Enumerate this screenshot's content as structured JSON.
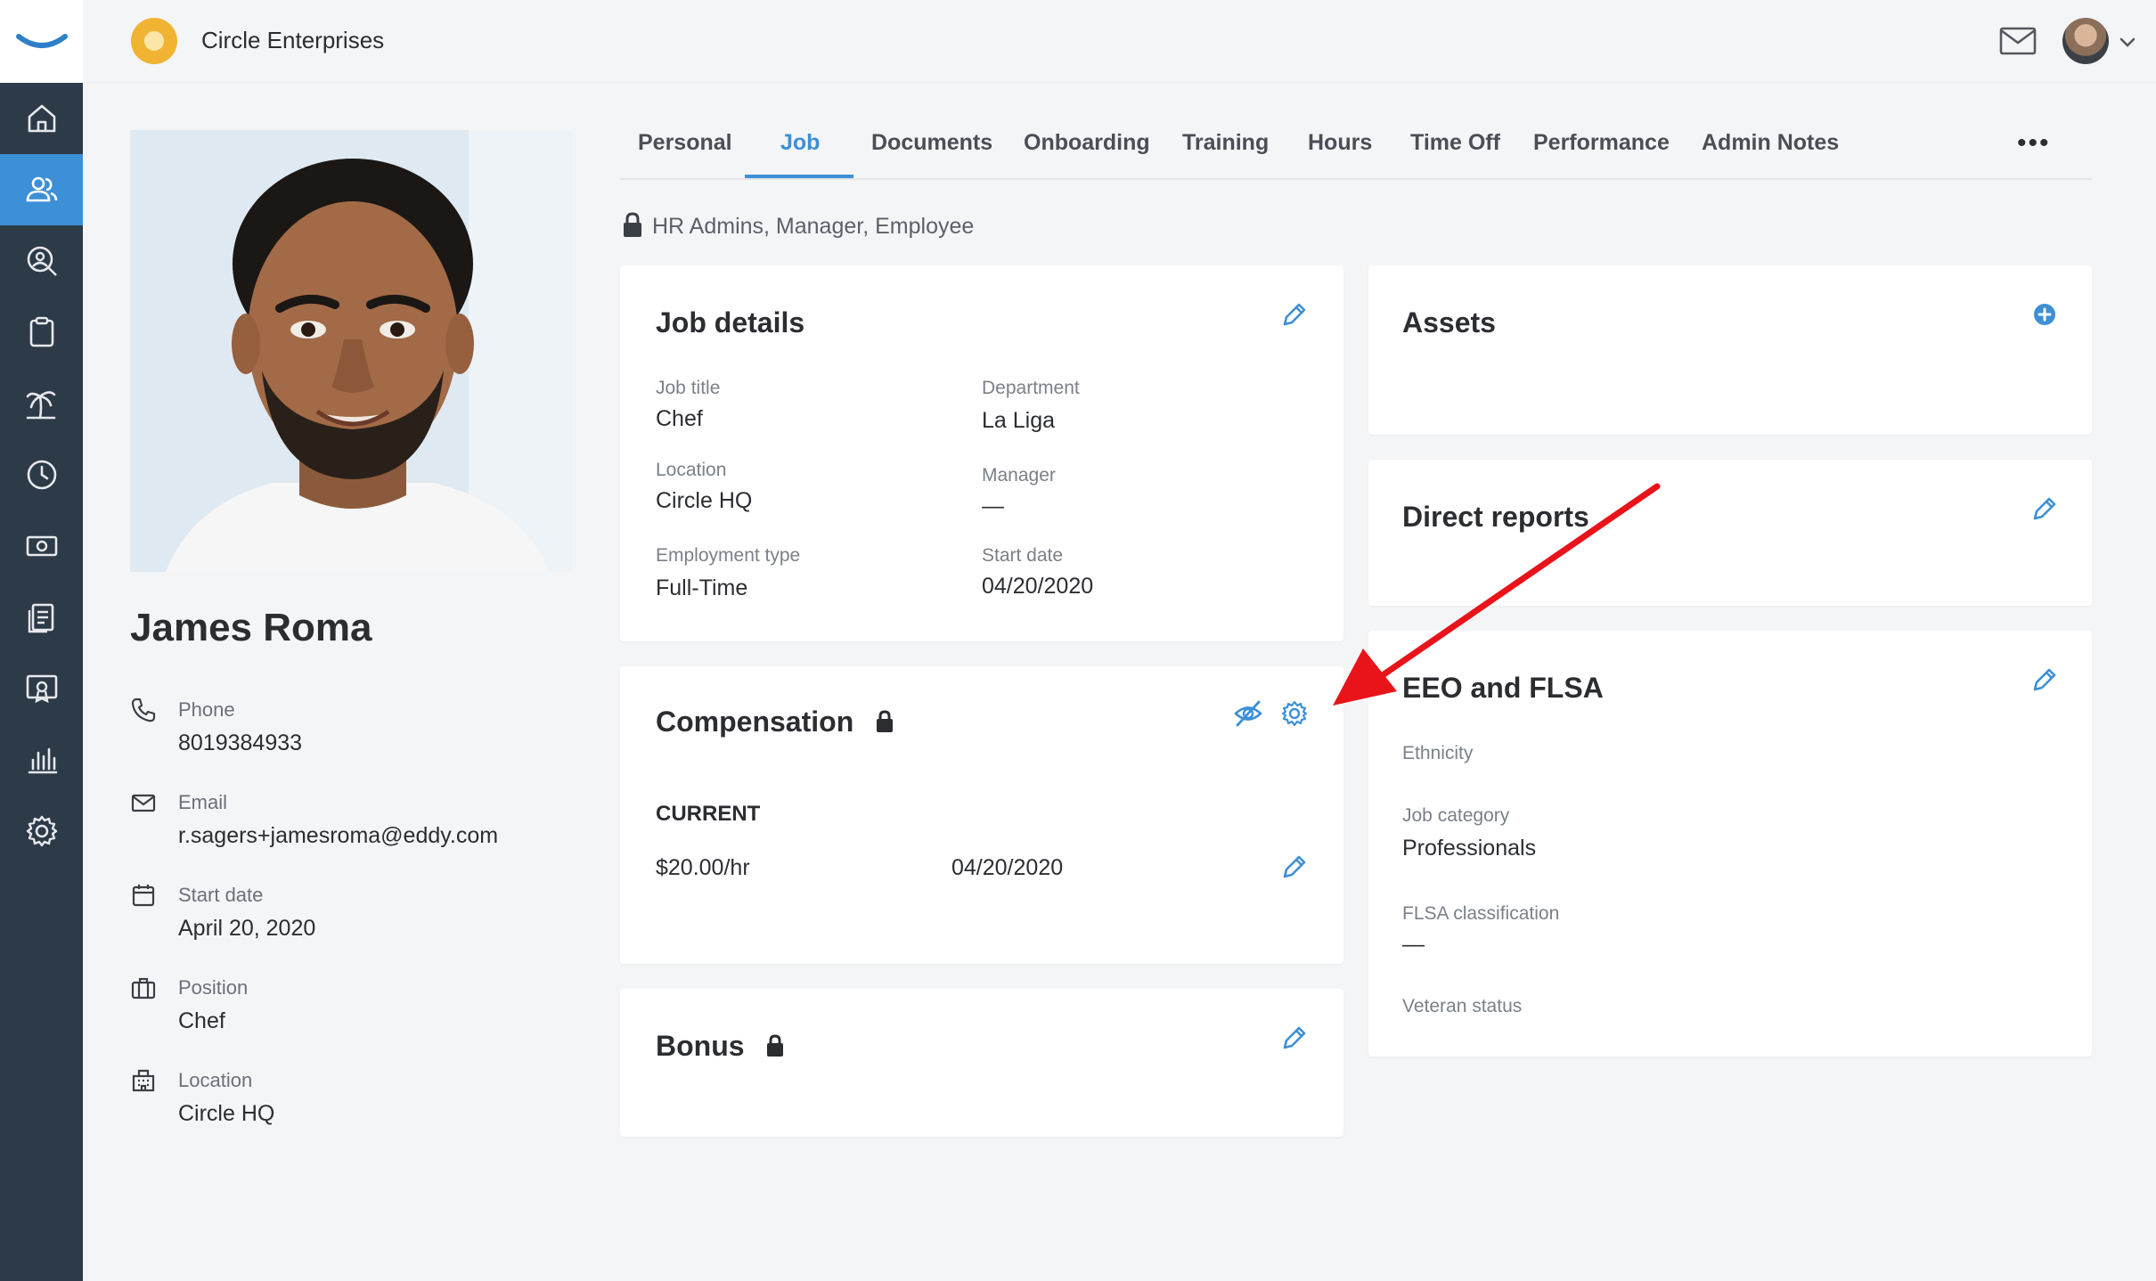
{
  "topbar": {
    "company_name": "Circle Enterprises",
    "mail_icon": "mail-icon",
    "avatar_icon": "user-avatar",
    "chevron_icon": "chevron-down-icon"
  },
  "sidebar": {
    "active_index": 1,
    "items": [
      {
        "icon": "home-icon"
      },
      {
        "icon": "people-icon"
      },
      {
        "icon": "search-person-icon"
      },
      {
        "icon": "clipboard-icon"
      },
      {
        "icon": "palm-tree-icon"
      },
      {
        "icon": "clock-icon"
      },
      {
        "icon": "money-icon"
      },
      {
        "icon": "documents-icon"
      },
      {
        "icon": "certificate-icon"
      },
      {
        "icon": "bar-chart-icon"
      },
      {
        "icon": "gear-icon"
      }
    ]
  },
  "profile": {
    "name": "James Roma",
    "fields": [
      {
        "label": "Phone",
        "value": "8019384933"
      },
      {
        "label": "Email",
        "value": "r.sagers+jamesroma@eddy.com"
      },
      {
        "label": "Start date",
        "value": "April 20, 2020"
      },
      {
        "label": "Position",
        "value": "Chef"
      },
      {
        "label": "Location",
        "value": "Circle HQ"
      }
    ]
  },
  "tabs": {
    "items": [
      "Personal",
      "Job",
      "Documents",
      "Onboarding",
      "Training",
      "Hours",
      "Time Off",
      "Performance",
      "Admin Notes"
    ],
    "active": "Job",
    "more": "•••"
  },
  "access_note": "HR Admins, Manager, Employee",
  "job_details": {
    "title": "Job details",
    "fields": [
      {
        "label": "Job title",
        "value": "Chef"
      },
      {
        "label": "Department",
        "value": "La Liga"
      },
      {
        "label": "Location",
        "value": "Circle HQ"
      },
      {
        "label": "Manager",
        "value": "—"
      },
      {
        "label": "Employment type",
        "value": "Full-Time"
      },
      {
        "label": "Start date",
        "value": "04/20/2020"
      }
    ]
  },
  "compensation": {
    "title": "Compensation",
    "section_label": "CURRENT",
    "rate": "$20.00/hr",
    "date": "04/20/2020"
  },
  "bonus": {
    "title": "Bonus"
  },
  "assets": {
    "title": "Assets"
  },
  "direct_reports": {
    "title": "Direct reports"
  },
  "eeo": {
    "title": "EEO and FLSA",
    "fields": [
      {
        "label": "Ethnicity",
        "value": ""
      },
      {
        "label": "Job category",
        "value": "Professionals"
      },
      {
        "label": "FLSA classification",
        "value": "—"
      },
      {
        "label": "Veteran status",
        "value": ""
      }
    ]
  },
  "colors": {
    "accent": "#3d8fd6",
    "sidebar": "#2d3a48",
    "annotation_arrow": "#e8141a",
    "brand_logo": "#f0b432"
  }
}
